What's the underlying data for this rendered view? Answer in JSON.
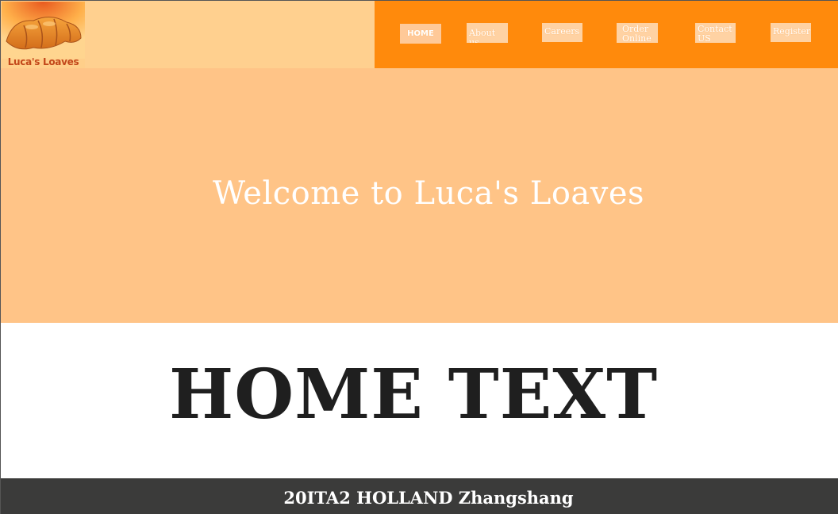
{
  "brand": {
    "name": "Luca's Loaves"
  },
  "nav": {
    "items": [
      {
        "label": "HOME",
        "active": true
      },
      {
        "label": "About us"
      },
      {
        "label": "Careers"
      },
      {
        "label": "Order Online"
      },
      {
        "label": "Contact US"
      },
      {
        "label": "Register"
      }
    ]
  },
  "hero": {
    "title": "Welcome to Luca's Loaves"
  },
  "main": {
    "heading": "HOME TEXT"
  },
  "footer": {
    "text": "20ITA2 HOLLAND Zhangshang"
  },
  "colors": {
    "header_left": "#ffd08f",
    "header_right": "#ff8a0c",
    "hero_bg": "#ffc487",
    "footer_bg": "#3b3b3a"
  }
}
